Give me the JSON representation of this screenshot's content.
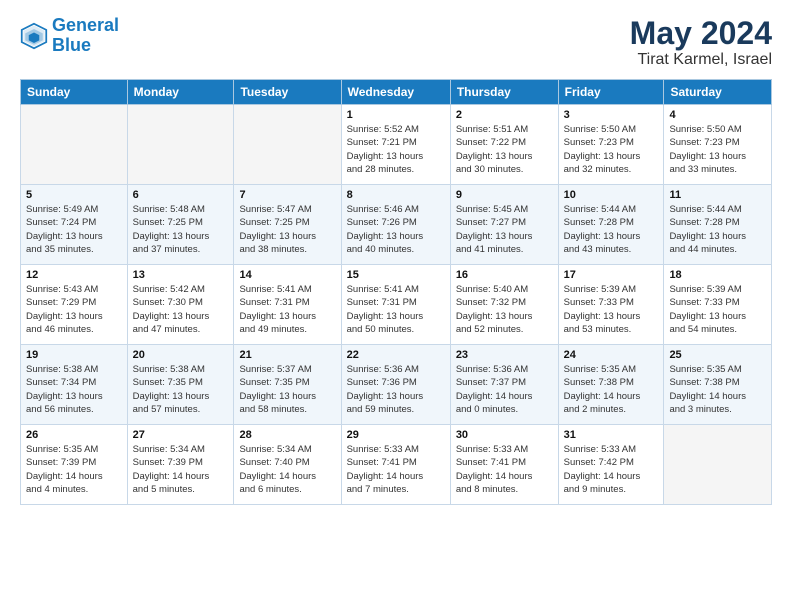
{
  "header": {
    "logo_line1": "General",
    "logo_line2": "Blue",
    "month_title": "May 2024",
    "location": "Tirat Karmel, Israel"
  },
  "weekdays": [
    "Sunday",
    "Monday",
    "Tuesday",
    "Wednesday",
    "Thursday",
    "Friday",
    "Saturday"
  ],
  "weeks": [
    [
      {
        "day": "",
        "info": ""
      },
      {
        "day": "",
        "info": ""
      },
      {
        "day": "",
        "info": ""
      },
      {
        "day": "1",
        "info": "Sunrise: 5:52 AM\nSunset: 7:21 PM\nDaylight: 13 hours\nand 28 minutes."
      },
      {
        "day": "2",
        "info": "Sunrise: 5:51 AM\nSunset: 7:22 PM\nDaylight: 13 hours\nand 30 minutes."
      },
      {
        "day": "3",
        "info": "Sunrise: 5:50 AM\nSunset: 7:23 PM\nDaylight: 13 hours\nand 32 minutes."
      },
      {
        "day": "4",
        "info": "Sunrise: 5:50 AM\nSunset: 7:23 PM\nDaylight: 13 hours\nand 33 minutes."
      }
    ],
    [
      {
        "day": "5",
        "info": "Sunrise: 5:49 AM\nSunset: 7:24 PM\nDaylight: 13 hours\nand 35 minutes."
      },
      {
        "day": "6",
        "info": "Sunrise: 5:48 AM\nSunset: 7:25 PM\nDaylight: 13 hours\nand 37 minutes."
      },
      {
        "day": "7",
        "info": "Sunrise: 5:47 AM\nSunset: 7:25 PM\nDaylight: 13 hours\nand 38 minutes."
      },
      {
        "day": "8",
        "info": "Sunrise: 5:46 AM\nSunset: 7:26 PM\nDaylight: 13 hours\nand 40 minutes."
      },
      {
        "day": "9",
        "info": "Sunrise: 5:45 AM\nSunset: 7:27 PM\nDaylight: 13 hours\nand 41 minutes."
      },
      {
        "day": "10",
        "info": "Sunrise: 5:44 AM\nSunset: 7:28 PM\nDaylight: 13 hours\nand 43 minutes."
      },
      {
        "day": "11",
        "info": "Sunrise: 5:44 AM\nSunset: 7:28 PM\nDaylight: 13 hours\nand 44 minutes."
      }
    ],
    [
      {
        "day": "12",
        "info": "Sunrise: 5:43 AM\nSunset: 7:29 PM\nDaylight: 13 hours\nand 46 minutes."
      },
      {
        "day": "13",
        "info": "Sunrise: 5:42 AM\nSunset: 7:30 PM\nDaylight: 13 hours\nand 47 minutes."
      },
      {
        "day": "14",
        "info": "Sunrise: 5:41 AM\nSunset: 7:31 PM\nDaylight: 13 hours\nand 49 minutes."
      },
      {
        "day": "15",
        "info": "Sunrise: 5:41 AM\nSunset: 7:31 PM\nDaylight: 13 hours\nand 50 minutes."
      },
      {
        "day": "16",
        "info": "Sunrise: 5:40 AM\nSunset: 7:32 PM\nDaylight: 13 hours\nand 52 minutes."
      },
      {
        "day": "17",
        "info": "Sunrise: 5:39 AM\nSunset: 7:33 PM\nDaylight: 13 hours\nand 53 minutes."
      },
      {
        "day": "18",
        "info": "Sunrise: 5:39 AM\nSunset: 7:33 PM\nDaylight: 13 hours\nand 54 minutes."
      }
    ],
    [
      {
        "day": "19",
        "info": "Sunrise: 5:38 AM\nSunset: 7:34 PM\nDaylight: 13 hours\nand 56 minutes."
      },
      {
        "day": "20",
        "info": "Sunrise: 5:38 AM\nSunset: 7:35 PM\nDaylight: 13 hours\nand 57 minutes."
      },
      {
        "day": "21",
        "info": "Sunrise: 5:37 AM\nSunset: 7:35 PM\nDaylight: 13 hours\nand 58 minutes."
      },
      {
        "day": "22",
        "info": "Sunrise: 5:36 AM\nSunset: 7:36 PM\nDaylight: 13 hours\nand 59 minutes."
      },
      {
        "day": "23",
        "info": "Sunrise: 5:36 AM\nSunset: 7:37 PM\nDaylight: 14 hours\nand 0 minutes."
      },
      {
        "day": "24",
        "info": "Sunrise: 5:35 AM\nSunset: 7:38 PM\nDaylight: 14 hours\nand 2 minutes."
      },
      {
        "day": "25",
        "info": "Sunrise: 5:35 AM\nSunset: 7:38 PM\nDaylight: 14 hours\nand 3 minutes."
      }
    ],
    [
      {
        "day": "26",
        "info": "Sunrise: 5:35 AM\nSunset: 7:39 PM\nDaylight: 14 hours\nand 4 minutes."
      },
      {
        "day": "27",
        "info": "Sunrise: 5:34 AM\nSunset: 7:39 PM\nDaylight: 14 hours\nand 5 minutes."
      },
      {
        "day": "28",
        "info": "Sunrise: 5:34 AM\nSunset: 7:40 PM\nDaylight: 14 hours\nand 6 minutes."
      },
      {
        "day": "29",
        "info": "Sunrise: 5:33 AM\nSunset: 7:41 PM\nDaylight: 14 hours\nand 7 minutes."
      },
      {
        "day": "30",
        "info": "Sunrise: 5:33 AM\nSunset: 7:41 PM\nDaylight: 14 hours\nand 8 minutes."
      },
      {
        "day": "31",
        "info": "Sunrise: 5:33 AM\nSunset: 7:42 PM\nDaylight: 14 hours\nand 9 minutes."
      },
      {
        "day": "",
        "info": ""
      }
    ]
  ]
}
